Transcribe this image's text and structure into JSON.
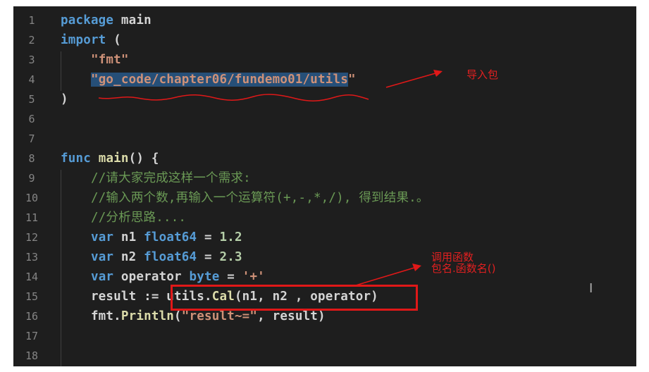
{
  "editor": {
    "lines": [
      {
        "num": "1",
        "tokens": [
          [
            "kw",
            "package"
          ],
          [
            "p",
            " main"
          ]
        ]
      },
      {
        "num": "2",
        "tokens": [
          [
            "kw",
            "import"
          ],
          [
            "p",
            " ("
          ]
        ]
      },
      {
        "num": "3",
        "tokens": [
          [
            "p",
            "    "
          ],
          [
            "str",
            "\"fmt\""
          ]
        ]
      },
      {
        "num": "4",
        "tokens": [
          [
            "p",
            "    "
          ],
          [
            "strsel",
            "\"go_code/chapter06/fundemo01/utils"
          ],
          [
            "str",
            "\""
          ]
        ]
      },
      {
        "num": "5",
        "tokens": [
          [
            "p",
            ")"
          ]
        ]
      },
      {
        "num": "6",
        "tokens": []
      },
      {
        "num": "7",
        "tokens": []
      },
      {
        "num": "8",
        "tokens": [
          [
            "kw",
            "func"
          ],
          [
            "p",
            " "
          ],
          [
            "fn",
            "main"
          ],
          [
            "p",
            "() {"
          ]
        ]
      },
      {
        "num": "9",
        "tokens": [
          [
            "p",
            "    "
          ],
          [
            "cm",
            "//请大家完成这样一个需求:"
          ]
        ]
      },
      {
        "num": "10",
        "tokens": [
          [
            "p",
            "    "
          ],
          [
            "cm",
            "//输入两个数,再输入一个运算符(+,-,*,/), 得到结果.。"
          ]
        ]
      },
      {
        "num": "11",
        "tokens": [
          [
            "p",
            "    "
          ],
          [
            "cm",
            "//分析思路...."
          ]
        ]
      },
      {
        "num": "12",
        "tokens": [
          [
            "p",
            "    "
          ],
          [
            "kw",
            "var"
          ],
          [
            "p",
            " n1 "
          ],
          [
            "kw",
            "float64"
          ],
          [
            "p",
            " = "
          ],
          [
            "num",
            "1.2"
          ]
        ]
      },
      {
        "num": "13",
        "tokens": [
          [
            "p",
            "    "
          ],
          [
            "kw",
            "var"
          ],
          [
            "p",
            " n2 "
          ],
          [
            "kw",
            "float64"
          ],
          [
            "p",
            " = "
          ],
          [
            "num",
            "2.3"
          ]
        ]
      },
      {
        "num": "14",
        "tokens": [
          [
            "p",
            "    "
          ],
          [
            "kw",
            "var"
          ],
          [
            "p",
            " operator "
          ],
          [
            "kw",
            "byte"
          ],
          [
            "p",
            " = "
          ],
          [
            "str",
            "'+'"
          ]
        ]
      },
      {
        "num": "15",
        "tokens": [
          [
            "p",
            "    result := utils."
          ],
          [
            "fn",
            "Cal"
          ],
          [
            "p",
            "(n1, n2 , operator)"
          ]
        ]
      },
      {
        "num": "16",
        "tokens": [
          [
            "p",
            "    fmt."
          ],
          [
            "fn",
            "Println"
          ],
          [
            "p",
            "("
          ],
          [
            "str",
            "\"result~=\""
          ],
          [
            "p",
            ", result)"
          ]
        ]
      },
      {
        "num": "17",
        "tokens": []
      },
      {
        "num": "18",
        "tokens": []
      }
    ]
  },
  "annotations": {
    "import_note": "导入包",
    "call_note_line1": "调用函数",
    "call_note_line2": "包名.函数名()"
  },
  "colors": {
    "background": "#1e1e1e",
    "keyword": "#569cd6",
    "string": "#ce9178",
    "comment": "#6a9955",
    "function": "#dcdcaa",
    "number": "#b5cea8",
    "annotation_red": "#e01818",
    "selection": "#264f78"
  },
  "cursor_icon": "text-cursor-icon"
}
